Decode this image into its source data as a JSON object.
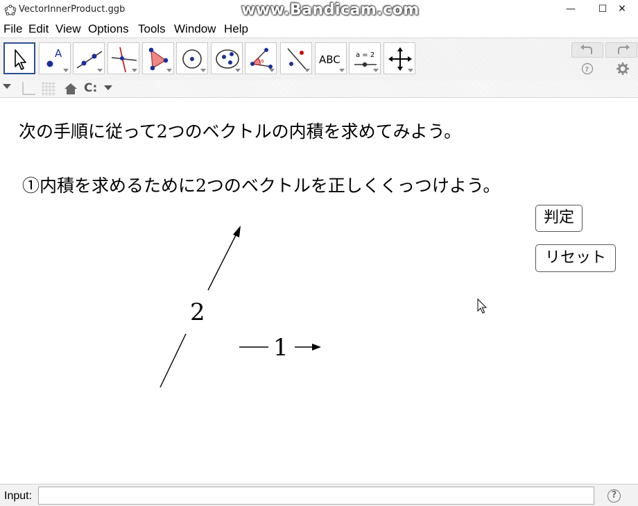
{
  "window": {
    "title": "VectorInnerProduct.ggb",
    "watermark": "www.Bandicam.com",
    "minimize_glyph": "—",
    "maximize_glyph": "☐",
    "close_glyph": "✕"
  },
  "menu": {
    "items": [
      "File",
      "Edit",
      "View",
      "Options",
      "Tools",
      "Window",
      "Help"
    ]
  },
  "toolbar": {
    "tools": [
      {
        "name": "move-tool-icon",
        "active": true
      },
      {
        "name": "point-tool-icon"
      },
      {
        "name": "line-tool-icon"
      },
      {
        "name": "perpendicular-line-tool-icon"
      },
      {
        "name": "polygon-tool-icon"
      },
      {
        "name": "circle-tool-icon"
      },
      {
        "name": "ellipse-tool-icon"
      },
      {
        "name": "angle-tool-icon"
      },
      {
        "name": "reflect-tool-icon"
      },
      {
        "name": "text-tool-icon",
        "label": "ABC"
      },
      {
        "name": "slider-tool-icon",
        "label": "a = 2"
      },
      {
        "name": "move-graphics-view-tool-icon"
      }
    ],
    "undo_icon": "undo-icon",
    "redo_icon": "redo-icon"
  },
  "stylebar": {
    "icons": [
      "stylebar-toggle-icon",
      "axes-icon",
      "grid-icon",
      "home-icon",
      "point-capturing-icon"
    ],
    "capture_label": "C:"
  },
  "canvas": {
    "instruction_line1": "次の手順に従って2つのベクトルの内積を求めてみよう。",
    "instruction_line2": "①内積を求めるために2つのベクトルを正しくくっつけよう。",
    "judge_button": "判定",
    "reset_button": "リセット",
    "vector_long_label": "2",
    "vector_short_label": "1"
  },
  "inputbar": {
    "label": "Input:",
    "value": "",
    "help_glyph": "?"
  }
}
